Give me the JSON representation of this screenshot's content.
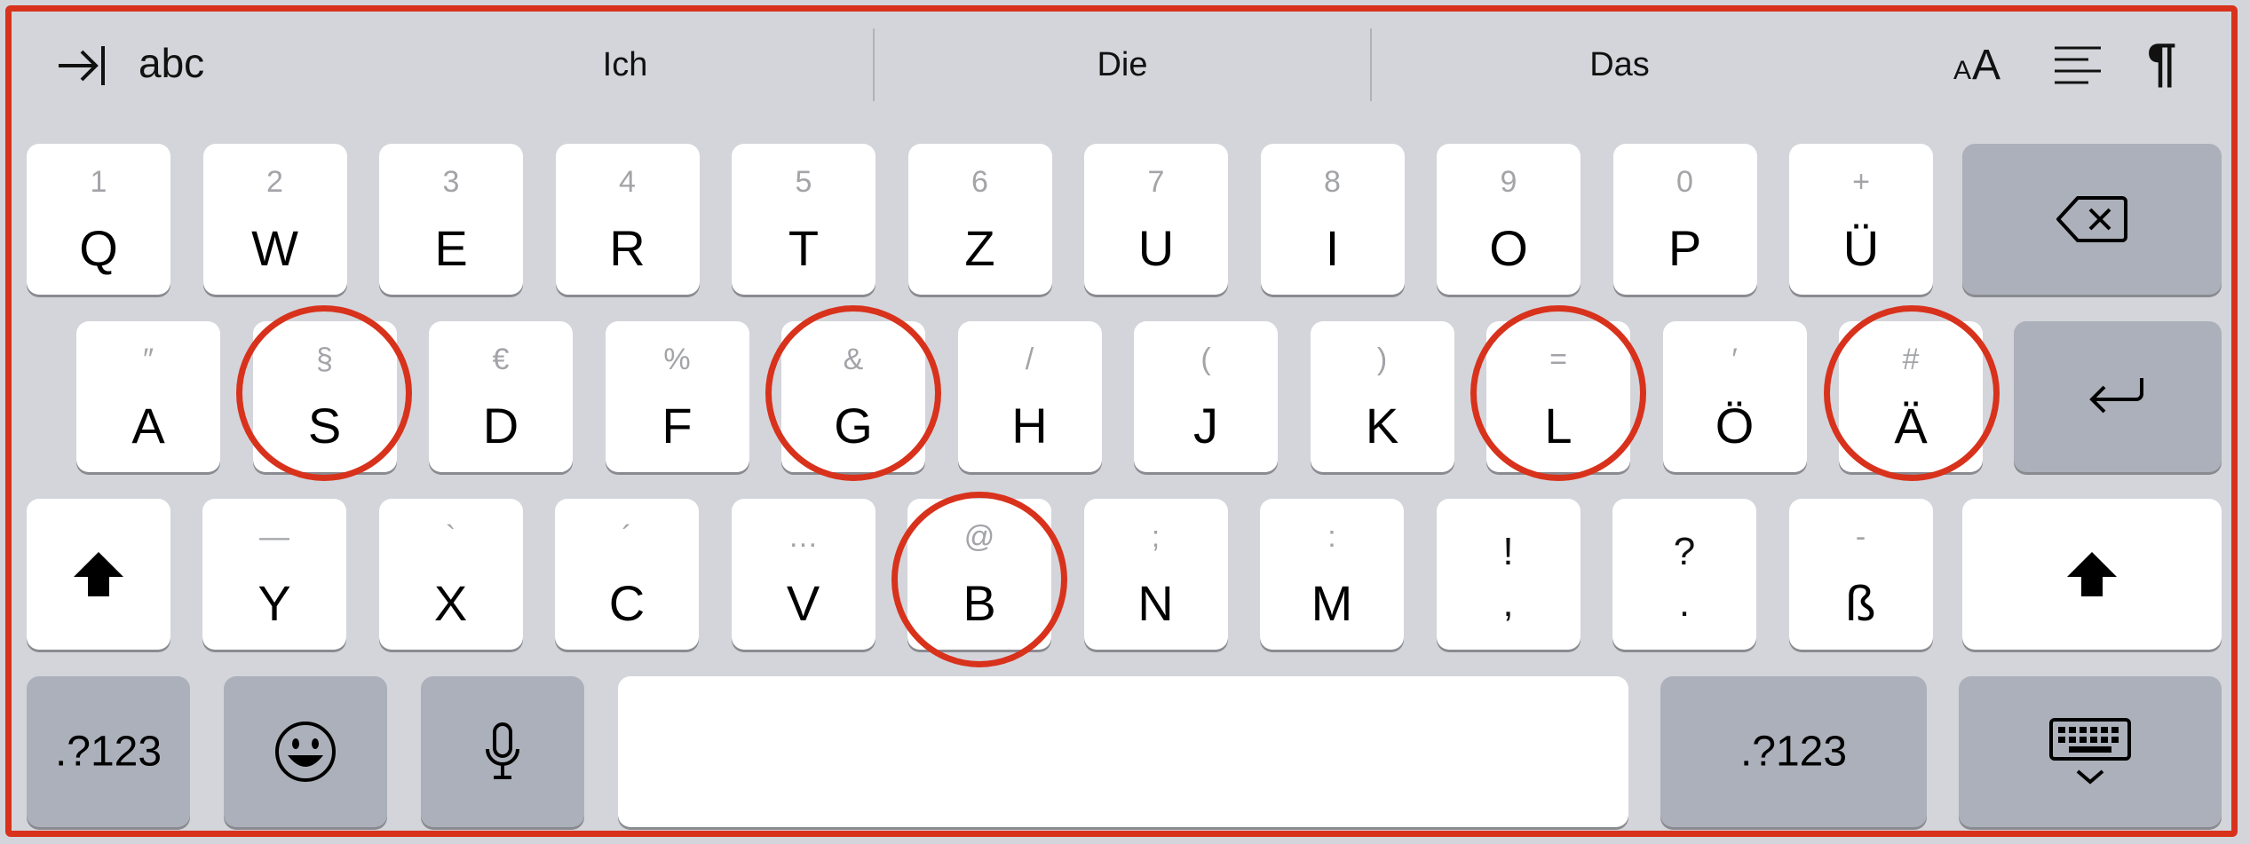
{
  "toolbar": {
    "abc_label": "abc",
    "suggestions": [
      "Ich",
      "Die",
      "Das"
    ],
    "format_icon_label": "AA",
    "paragraph_icon": "¶"
  },
  "rows": {
    "row1": [
      {
        "sub": "1",
        "main": "Q"
      },
      {
        "sub": "2",
        "main": "W"
      },
      {
        "sub": "3",
        "main": "E"
      },
      {
        "sub": "4",
        "main": "R"
      },
      {
        "sub": "5",
        "main": "T"
      },
      {
        "sub": "6",
        "main": "Z"
      },
      {
        "sub": "7",
        "main": "U"
      },
      {
        "sub": "8",
        "main": "I"
      },
      {
        "sub": "9",
        "main": "O"
      },
      {
        "sub": "0",
        "main": "P"
      },
      {
        "sub": "+",
        "main": "Ü"
      }
    ],
    "row2": [
      {
        "sub": "″",
        "main": "A"
      },
      {
        "sub": "§",
        "main": "S"
      },
      {
        "sub": "€",
        "main": "D"
      },
      {
        "sub": "%",
        "main": "F"
      },
      {
        "sub": "&",
        "main": "G"
      },
      {
        "sub": "/",
        "main": "H"
      },
      {
        "sub": "(",
        "main": "J"
      },
      {
        "sub": ")",
        "main": "K"
      },
      {
        "sub": "=",
        "main": "L"
      },
      {
        "sub": "′",
        "main": "Ö"
      },
      {
        "sub": "#",
        "main": "Ä"
      }
    ],
    "row3": [
      {
        "sub": "—",
        "main": "Y"
      },
      {
        "sub": "`",
        "main": "X"
      },
      {
        "sub": "´",
        "main": "C"
      },
      {
        "sub": "…",
        "main": "V"
      },
      {
        "sub": "@",
        "main": "B"
      },
      {
        "sub": ";",
        "main": "N"
      },
      {
        "sub": ":",
        "main": "M"
      },
      {
        "top": "!",
        "bottom": ","
      },
      {
        "top": "?",
        "bottom": "."
      },
      {
        "sub": "-",
        "main": "ß"
      }
    ],
    "row4": {
      "numbers_left": ".?123",
      "numbers_right": ".?123"
    }
  },
  "icons": {
    "tab": "tab-icon",
    "align": "align-icon",
    "backspace": "backspace-icon",
    "return": "return-icon",
    "shift": "shift-icon",
    "emoji": "emoji-icon",
    "mic": "microphone-icon",
    "dismiss": "keyboard-dismiss-icon"
  },
  "colors": {
    "annotation": "#d8321c",
    "keyboard_bg": "#d4d5da",
    "key": "#ffffff",
    "function_key": "#abb0ba"
  }
}
